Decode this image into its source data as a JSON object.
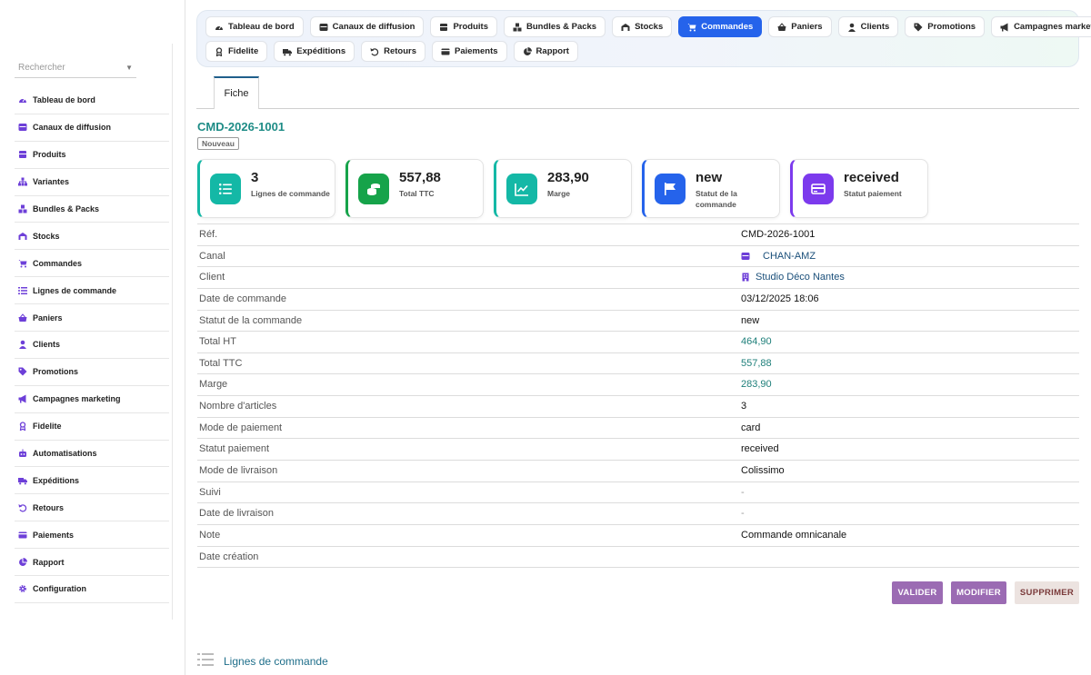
{
  "sidebar": {
    "search_placeholder": "Rechercher",
    "items": [
      {
        "label": "Tableau de bord",
        "icon": "dashboard-icon"
      },
      {
        "label": "Canaux de diffusion",
        "icon": "channels-icon"
      },
      {
        "label": "Produits",
        "icon": "products-icon"
      },
      {
        "label": "Variantes",
        "icon": "variants-icon"
      },
      {
        "label": "Bundles & Packs",
        "icon": "bundles-icon"
      },
      {
        "label": "Stocks",
        "icon": "stocks-icon"
      },
      {
        "label": "Commandes",
        "icon": "cart-icon"
      },
      {
        "label": "Lignes de commande",
        "icon": "list-icon"
      },
      {
        "label": "Paniers",
        "icon": "basket-icon"
      },
      {
        "label": "Clients",
        "icon": "user-icon"
      },
      {
        "label": "Promotions",
        "icon": "tag-icon"
      },
      {
        "label": "Campagnes marketing",
        "icon": "megaphone-icon"
      },
      {
        "label": "Fidelite",
        "icon": "award-icon"
      },
      {
        "label": "Automatisations",
        "icon": "robot-icon"
      },
      {
        "label": "Expéditions",
        "icon": "truck-icon"
      },
      {
        "label": "Retours",
        "icon": "undo-icon"
      },
      {
        "label": "Paiements",
        "icon": "card-icon"
      },
      {
        "label": "Rapport",
        "icon": "pie-chart-icon"
      },
      {
        "label": "Configuration",
        "icon": "gear-icon"
      }
    ]
  },
  "topnav": {
    "row1": [
      {
        "label": "Tableau de bord",
        "icon": "dashboard-icon",
        "active": false
      },
      {
        "label": "Canaux de diffusion",
        "icon": "channels-icon",
        "active": false
      },
      {
        "label": "Produits",
        "icon": "products-icon",
        "active": false
      },
      {
        "label": "Bundles & Packs",
        "icon": "bundles-icon",
        "active": false
      },
      {
        "label": "Stocks",
        "icon": "stocks-icon",
        "active": false
      },
      {
        "label": "Commandes",
        "icon": "cart-icon",
        "active": true
      },
      {
        "label": "Paniers",
        "icon": "basket-icon",
        "active": false
      },
      {
        "label": "Clients",
        "icon": "user-icon",
        "active": false
      },
      {
        "label": "Promotions",
        "icon": "tag-icon",
        "active": false
      },
      {
        "label": "Campagnes marketing",
        "icon": "megaphone-icon",
        "active": false
      }
    ],
    "row2": [
      {
        "label": "Fidelite",
        "icon": "award-icon",
        "active": false
      },
      {
        "label": "Expéditions",
        "icon": "truck-icon",
        "active": false
      },
      {
        "label": "Retours",
        "icon": "undo-icon",
        "active": false
      },
      {
        "label": "Paiements",
        "icon": "card-icon",
        "active": false
      },
      {
        "label": "Rapport",
        "icon": "pie-chart-icon",
        "active": false
      }
    ]
  },
  "subtabs": {
    "fiche": "Fiche"
  },
  "record": {
    "title": "CMD-2026-1001",
    "status": "Nouveau"
  },
  "cards": [
    {
      "value": "3",
      "label": "Lignes de commande",
      "accent": "#14b8a6",
      "icon": "list-icon"
    },
    {
      "value": "557,88",
      "label": "Total TTC",
      "accent": "#16a34a",
      "icon": "coins-icon"
    },
    {
      "value": "283,90",
      "label": "Marge",
      "accent": "#14b8a6",
      "icon": "trend-icon"
    },
    {
      "value": "new",
      "label": "Statut de la commande",
      "accent": "#2563eb",
      "icon": "flag-icon"
    },
    {
      "value": "received",
      "label": "Statut paiement",
      "accent": "#7c3aed",
      "icon": "card-icon"
    }
  ],
  "details": [
    {
      "key": "Réf.",
      "value": "CMD-2026-1001",
      "style": ""
    },
    {
      "key": "Canal",
      "value": "CHAN-AMZ",
      "style": "link",
      "icon": "channels-icon"
    },
    {
      "key": "Client",
      "value": "Studio Déco Nantes",
      "style": "link",
      "icon": "building-icon"
    },
    {
      "key": "Date de commande",
      "value": "03/12/2025 18:06",
      "style": ""
    },
    {
      "key": "Statut de la commande",
      "value": "new",
      "style": ""
    },
    {
      "key": "Total HT",
      "value": "464,90",
      "style": "num"
    },
    {
      "key": "Total TTC",
      "value": "557,88",
      "style": "num"
    },
    {
      "key": "Marge",
      "value": "283,90",
      "style": "num"
    },
    {
      "key": "Nombre d'articles",
      "value": "3",
      "style": ""
    },
    {
      "key": "Mode de paiement",
      "value": "card",
      "style": ""
    },
    {
      "key": "Statut paiement",
      "value": "received",
      "style": ""
    },
    {
      "key": "Mode de livraison",
      "value": "Colissimo",
      "style": ""
    },
    {
      "key": "Suivi",
      "value": "-",
      "style": "dash"
    },
    {
      "key": "Date de livraison",
      "value": "-",
      "style": "dash"
    },
    {
      "key": "Note",
      "value": "Commande omnicanale",
      "style": ""
    },
    {
      "key": "Date création",
      "value": "",
      "style": ""
    }
  ],
  "actions": {
    "validate": "VALIDER",
    "modify": "MODIFIER",
    "delete": "SUPPRIMER"
  },
  "section": {
    "title": "Lignes de commande",
    "icon": "list-icon"
  },
  "colors": {
    "primary": "#2563eb",
    "teal": "#1e8c86",
    "action": "#9b6bb3"
  }
}
